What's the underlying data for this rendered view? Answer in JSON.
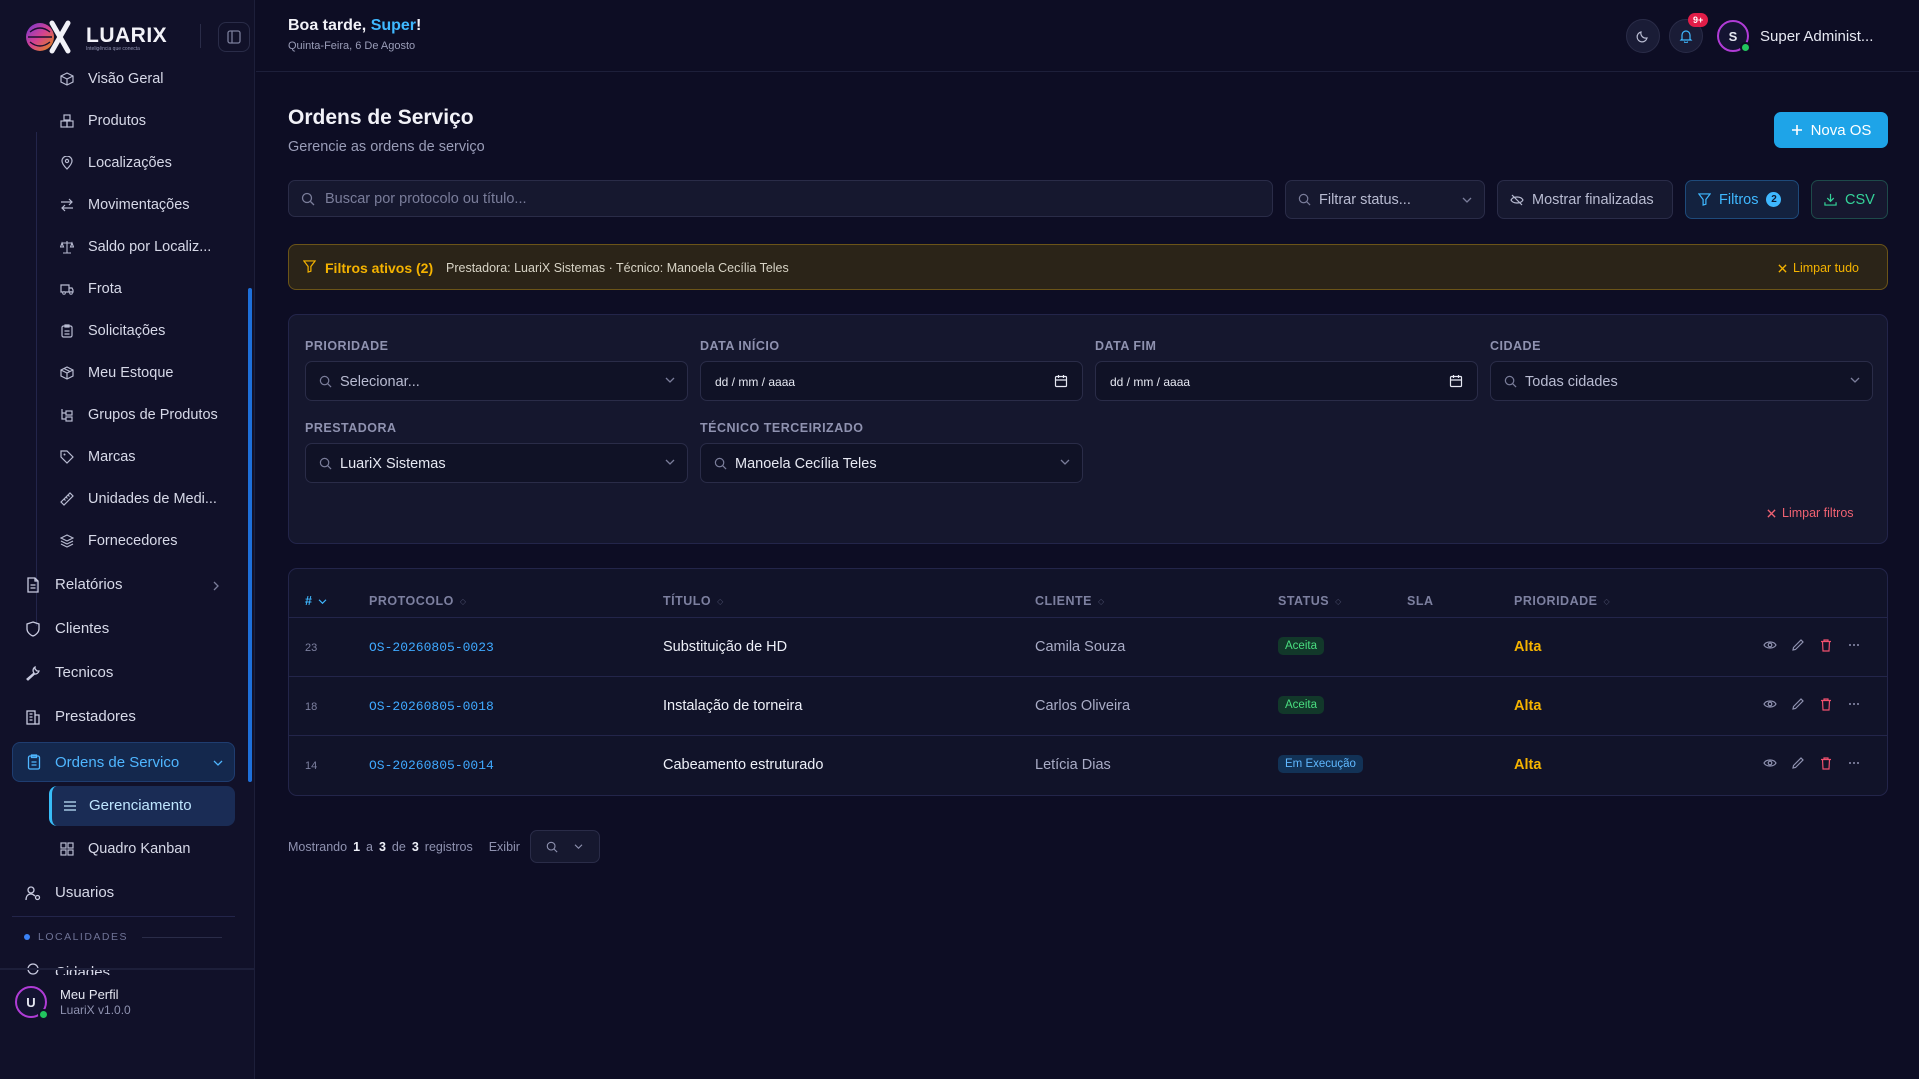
{
  "brand": {
    "name": "LUARIX",
    "tagline": "Inteligência que conecta"
  },
  "sidebar": {
    "sub_items": [
      {
        "label": "Visão Geral",
        "icon": "box-icon"
      },
      {
        "label": "Produtos",
        "icon": "boxes-icon"
      },
      {
        "label": "Localizações",
        "icon": "map-pin-icon"
      },
      {
        "label": "Movimentações",
        "icon": "arrows-icon"
      },
      {
        "label": "Saldo por Localiz...",
        "icon": "scale-icon"
      },
      {
        "label": "Frota",
        "icon": "truck-icon"
      },
      {
        "label": "Solicitações",
        "icon": "clipboard-icon"
      },
      {
        "label": "Meu Estoque",
        "icon": "package-icon"
      },
      {
        "label": "Grupos de Produtos",
        "icon": "tree-icon"
      },
      {
        "label": "Marcas",
        "icon": "tag-icon"
      },
      {
        "label": "Unidades de Medi...",
        "icon": "ruler-icon"
      },
      {
        "label": "Fornecedores",
        "icon": "layers-icon"
      }
    ],
    "top_items": [
      {
        "label": "Relatórios",
        "icon": "file-icon"
      },
      {
        "label": "Clientes",
        "icon": "shield-icon"
      },
      {
        "label": "Tecnicos",
        "icon": "wrench-icon"
      },
      {
        "label": "Prestadores",
        "icon": "building-icon"
      }
    ],
    "active_group": "Ordens de Servico",
    "active_sub": "Gerenciamento",
    "kanban": "Quadro Kanban",
    "usuarios": "Usuarios",
    "section": "LOCALIDADES",
    "cidades": "Cidades",
    "profile": {
      "name": "Meu Perfil",
      "version": "LuariX v1.0.0",
      "initial": "U"
    }
  },
  "header": {
    "greeting_prefix": "Boa tarde, ",
    "greeting_name": "Super",
    "greeting_suffix": "!",
    "date": "Quinta-Feira, 6 De Agosto",
    "notif_badge": "9+",
    "user_initial": "S",
    "user_name": "Super Administ..."
  },
  "page": {
    "title": "Ordens de Serviço",
    "subtitle": "Gerencie as ordens de serviço",
    "new_button": "Nova OS"
  },
  "toolbar": {
    "search_placeholder": "Buscar por protocolo ou título...",
    "status_filter": "Filtrar status...",
    "show_finished": "Mostrar finalizadas",
    "filters": "Filtros",
    "filters_count": "2",
    "csv": "CSV"
  },
  "active_filters": {
    "title": "Filtros ativos (2)",
    "description": "Prestadora: LuariX Sistemas · Técnico: Manoela Cecília Teles",
    "clear_all": "Limpar tudo"
  },
  "filter_panel": {
    "prioridade_label": "PRIORIDADE",
    "prioridade_value": "Selecionar...",
    "data_inicio_label": "DATA INÍCIO",
    "data_inicio_value": "dd / mm / aaaa",
    "data_fim_label": "DATA FIM",
    "data_fim_value": "dd / mm / aaaa",
    "cidade_label": "CIDADE",
    "cidade_value": "Todas cidades",
    "prestadora_label": "PRESTADORA",
    "prestadora_value": "LuariX Sistemas",
    "tecnico_label": "TÉCNICO TERCEIRIZADO",
    "tecnico_value": "Manoela Cecília Teles",
    "clear": "Limpar filtros"
  },
  "table": {
    "headers": [
      "#",
      "PROTOCOLO",
      "TÍTULO",
      "CLIENTE",
      "STATUS",
      "SLA",
      "PRIORIDADE"
    ],
    "rows": [
      {
        "num": "23",
        "protocol": "OS-20260805-0023",
        "title": "Substituição de HD",
        "client": "Camila Souza",
        "status": "Aceita",
        "status_color": "#4ade80",
        "priority": "Alta"
      },
      {
        "num": "18",
        "protocol": "OS-20260805-0018",
        "title": "Instalação de torneira",
        "client": "Carlos Oliveira",
        "status": "Aceita",
        "status_color": "#4ade80",
        "priority": "Alta"
      },
      {
        "num": "14",
        "protocol": "OS-20260805-0014",
        "title": "Cabeamento estruturado",
        "client": "Letícia Dias",
        "status": "Em Execução",
        "status_color": "#60b8ff",
        "priority": "Alta"
      }
    ]
  },
  "footer": {
    "showing": "Mostrando",
    "from": "1",
    "a": "a",
    "to": "3",
    "de": "de",
    "total": "3",
    "registros": "registros",
    "exibir": "Exibir"
  }
}
